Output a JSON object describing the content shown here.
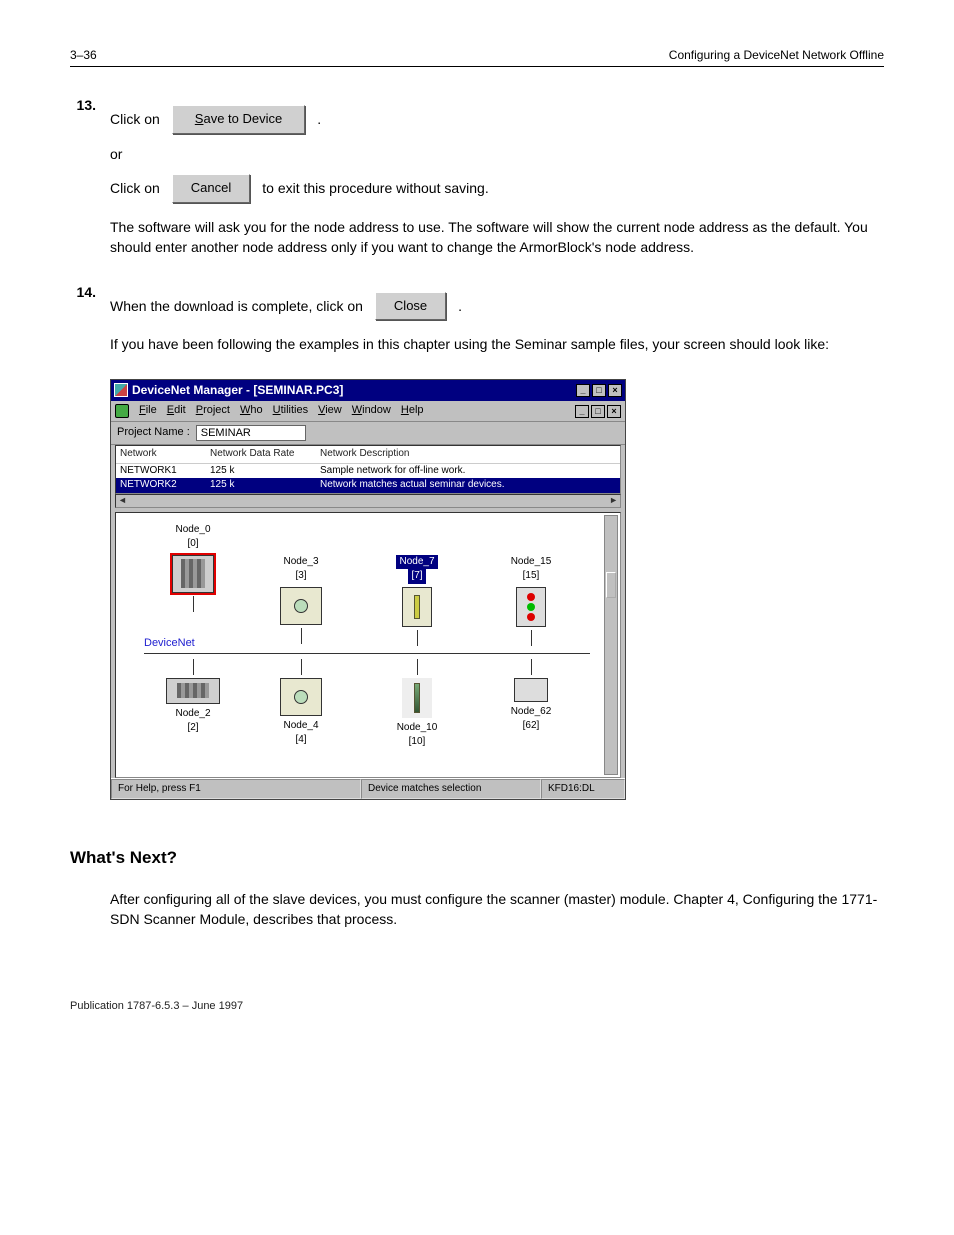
{
  "header": {
    "page_left": "3–36",
    "page_right": "Configuring a DeviceNet Network Offline"
  },
  "steps": {
    "s13": {
      "num": "13.",
      "lead": "Click on ",
      "btn": "Save to Device",
      "tail": "."
    },
    "s14_or": "or",
    "s14": {
      "lead": "Click on ",
      "btn": "Cancel",
      "tail": " to exit this procedure without saving."
    },
    "s15_text": "The software will ask you for the node address to use. The software will show the current node address as the default. You should enter another node address only if you want to change the ArmorBlock's node address.",
    "s16": {
      "num": "14.",
      "lead": "When the download is complete, click on ",
      "btn": "Close",
      "tail": "."
    },
    "s17": "If you have been following the examples in this chapter using the Seminar sample files, your screen should look like:"
  },
  "window": {
    "title": "DeviceNet Manager - [SEMINAR.PC3]",
    "menu": [
      "File",
      "Edit",
      "Project",
      "Who",
      "Utilities",
      "View",
      "Window",
      "Help"
    ],
    "project_label": "Project Name :",
    "project_value": "SEMINAR",
    "list_headers": [
      "Network",
      "Network Data Rate",
      "Network Description"
    ],
    "list_rows": [
      {
        "net": "NETWORK1",
        "rate": "125 k",
        "desc": "Sample network for off-line work."
      },
      {
        "net": "NETWORK2",
        "rate": "125 k",
        "desc": "Network matches actual seminar devices."
      }
    ],
    "bus_label": "DeviceNet",
    "nodes": {
      "n0": {
        "name": "Node_0",
        "addr": "[0]"
      },
      "n2": {
        "name": "Node_2",
        "addr": "[2]"
      },
      "n3": {
        "name": "Node_3",
        "addr": "[3]"
      },
      "n4": {
        "name": "Node_4",
        "addr": "[4]"
      },
      "n7": {
        "name": "Node_7",
        "addr": "[7]"
      },
      "n10": {
        "name": "Node_10",
        "addr": "[10]"
      },
      "n15": {
        "name": "Node_15",
        "addr": "[15]"
      },
      "n62": {
        "name": "Node_62",
        "addr": "[62]"
      }
    },
    "status_left": "For Help, press F1",
    "status_mid": "Device matches selection",
    "status_right": "KFD16:DL"
  },
  "ending": {
    "heading": "What's Next?",
    "para": "After configuring all of the slave devices, you must configure the scanner (master) module. Chapter 4, Configuring the 1771-SDN Scanner Module, describes that process."
  },
  "footer": "Publication 1787-6.5.3 – June 1997"
}
